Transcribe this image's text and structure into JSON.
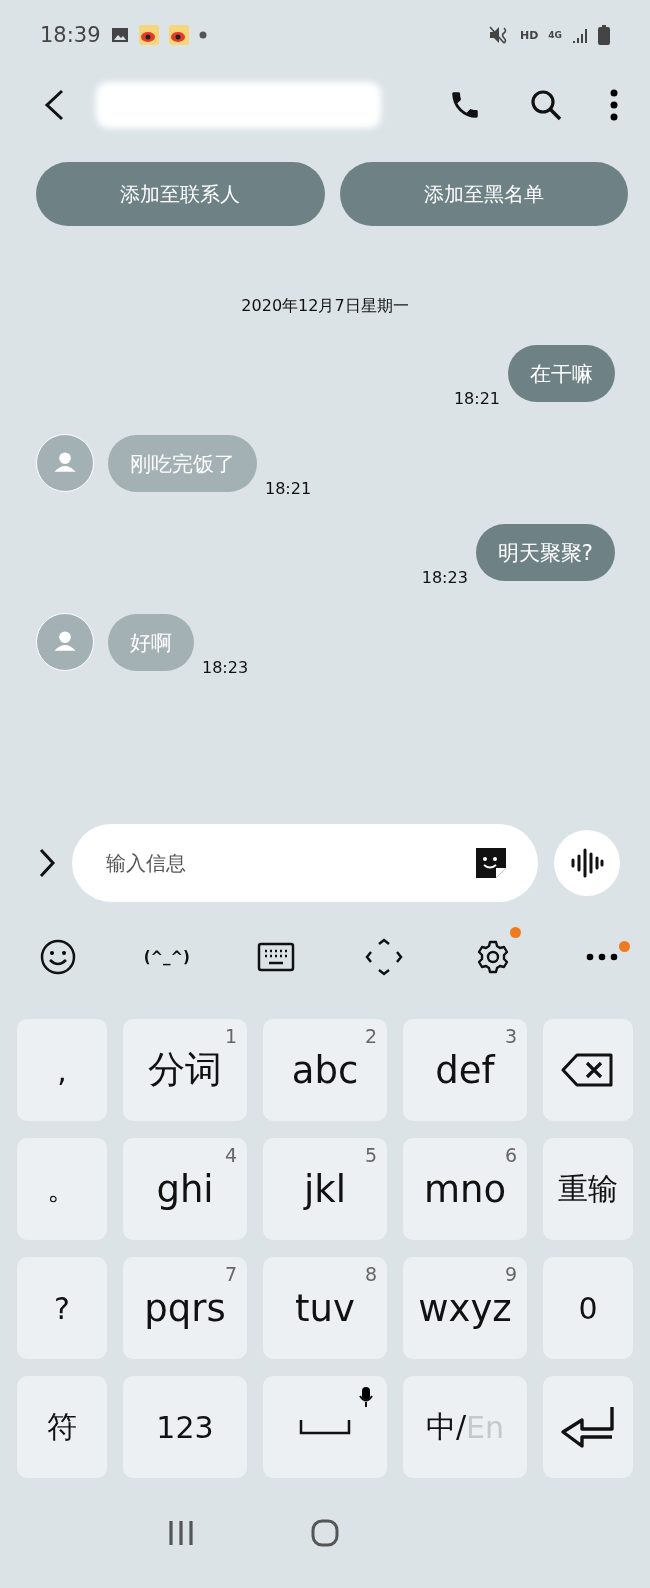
{
  "status_bar": {
    "time": "18:39",
    "hd": "HD",
    "network": "4G"
  },
  "actions": [
    "添加至联系人",
    "添加至黑名单"
  ],
  "date": "2020年12月7日星期一",
  "messages": [
    {
      "kind": "sent",
      "text": "在干嘛",
      "time": "18:21"
    },
    {
      "kind": "received",
      "text": "刚吃完饭了",
      "time": "18:21"
    },
    {
      "kind": "sent",
      "text": "明天聚聚?",
      "time": "18:23"
    },
    {
      "kind": "received",
      "text": "好啊",
      "time": "18:23"
    }
  ],
  "composer": {
    "placeholder": "输入信息"
  },
  "keyboard_toolbar": [
    {
      "kind": "emoji",
      "dot": false
    },
    {
      "kind": "kaomoji",
      "text": "(^_^)",
      "dot": false
    },
    {
      "kind": "keyboard",
      "dot": false
    },
    {
      "kind": "cursor",
      "dot": false
    },
    {
      "kind": "settings",
      "dot": true
    },
    {
      "kind": "more",
      "dot": true
    }
  ],
  "keys": [
    {
      "kind": "char",
      "text": ","
    },
    {
      "kind": "t9",
      "text": "分词",
      "digit": "1"
    },
    {
      "kind": "t9",
      "text": "abc",
      "digit": "2"
    },
    {
      "kind": "t9",
      "text": "def",
      "digit": "3"
    },
    {
      "kind": "backspace"
    },
    {
      "kind": "char",
      "text": "。"
    },
    {
      "kind": "t9",
      "text": "ghi",
      "digit": "4"
    },
    {
      "kind": "t9",
      "text": "jkl",
      "digit": "5"
    },
    {
      "kind": "t9",
      "text": "mno",
      "digit": "6"
    },
    {
      "kind": "char",
      "text": "重输"
    },
    {
      "kind": "char",
      "text": "?"
    },
    {
      "kind": "t9",
      "text": "pqrs",
      "digit": "7"
    },
    {
      "kind": "t9",
      "text": "tuv",
      "digit": "8"
    },
    {
      "kind": "t9",
      "text": "wxyz",
      "digit": "9"
    },
    {
      "kind": "char",
      "text": "0"
    },
    {
      "kind": "char",
      "text": "符"
    },
    {
      "kind": "char",
      "text": "123"
    },
    {
      "kind": "space"
    },
    {
      "kind": "lang",
      "text": "中/",
      "alt": "En"
    },
    {
      "kind": "enter"
    }
  ]
}
